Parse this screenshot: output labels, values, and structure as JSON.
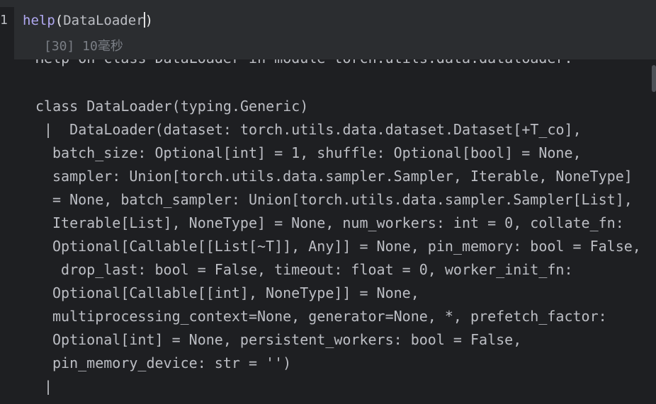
{
  "editor": {
    "gutter_line_number": "1",
    "code_function": "help",
    "code_open_paren": "(",
    "code_argument": "DataLoader",
    "code_close_paren": ")"
  },
  "execution": {
    "status_text": "[30] 10毫秒"
  },
  "output": {
    "partial_top_line": "Help on class DataLoader in module torch.utils.data.dataloader:",
    "lines": [
      "class DataLoader(typing.Generic)",
      " |  DataLoader(dataset: torch.utils.data.dataset.Dataset[+T_co],",
      "batch_size: Optional[int] = 1, shuffle: Optional[bool] = None,",
      "sampler: Union[torch.utils.data.sampler.Sampler, Iterable, NoneType]",
      "= None, batch_sampler: Union[torch.utils.data.sampler.Sampler[List],",
      "Iterable[List], NoneType] = None, num_workers: int = 0, collate_fn:",
      "Optional[Callable[[List[~T]], Any]] = None, pin_memory: bool = False,",
      " drop_last: bool = False, timeout: float = 0, worker_init_fn:",
      "Optional[Callable[[int], NoneType]] = None,",
      "multiprocessing_context=None, generator=None, *, prefetch_factor:",
      "Optional[int] = None, persistent_workers: bool = False,",
      "pin_memory_device: str = '')",
      " |"
    ]
  },
  "colors": {
    "background": "#1e1f22",
    "cell_background": "#2b2d30",
    "function_color": "#b0a8f0",
    "text_color": "#bcbec4",
    "status_color": "#7a7e85",
    "success_check": "#5fb865"
  },
  "icons": {
    "status_icon": "check-icon"
  }
}
